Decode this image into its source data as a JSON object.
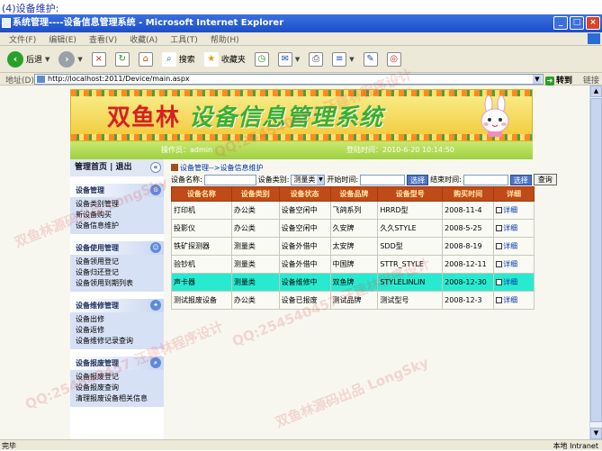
{
  "caption": "(4)设备维护:",
  "window": {
    "title": "系统管理----设备信息管理系统 - Microsoft Internet Explorer",
    "controls": [
      "_",
      "□",
      "×"
    ]
  },
  "menu": [
    "文件(F)",
    "编辑(E)",
    "查看(V)",
    "收藏(A)",
    "工具(T)",
    "帮助(H)"
  ],
  "toolbar": {
    "back_label": "后退",
    "search_label": "搜索",
    "favorites_label": "收藏夹"
  },
  "address": {
    "label": "地址(D)",
    "url": "http://localhost:2011/Device/main.aspx",
    "go_label": "转到",
    "links_label": "链接"
  },
  "banner": {
    "title_red": "双鱼林",
    "title_green": "设备信息管理系统"
  },
  "infobar": {
    "operator": "操作员：admin",
    "login_time": "登陆时间：2010-6-20 10:14:50"
  },
  "sidebar": {
    "top_links": "管理首页 | 退出",
    "collapse": "«",
    "groups": [
      {
        "title": "设备管理",
        "items": [
          "设备类别管理",
          "新设备购买",
          "设备信息维护"
        ]
      },
      {
        "title": "设备使用管理",
        "items": [
          "设备领用登记",
          "设备归还登记",
          "设备领用到期列表"
        ]
      },
      {
        "title": "设备维修管理",
        "items": [
          "设备出修",
          "设备返修",
          "设备维修记录查询"
        ]
      },
      {
        "title": "设备报废管理",
        "items": [
          "设备报废登记",
          "设备报废查询",
          "清理报废设备相关信息"
        ]
      }
    ]
  },
  "breadcrumb": "设备管理-->设备信息维护",
  "search": {
    "name_label": "设备名称:",
    "type_label": "设备类别:",
    "type_value": "测量类",
    "start_label": "开始时间:",
    "select1": "选择",
    "end_label": "结束时间:",
    "select2": "选择",
    "query": "查询"
  },
  "table": {
    "headers": [
      "设备名称",
      "设备类别",
      "设备状态",
      "设备品牌",
      "设备型号",
      "购买时间",
      "详细"
    ],
    "rows": [
      [
        "打印机",
        "办公类",
        "设备空闲中",
        "飞鸽系列",
        "HRRD型",
        "2008-11-4",
        "详细"
      ],
      [
        "投影仪",
        "办公类",
        "设备空闲中",
        "久安牌",
        "久久STYLE",
        "2008-5-25",
        "详细"
      ],
      [
        "铁矿探测器",
        "测量类",
        "设备外借中",
        "太安牌",
        "SDD型",
        "2008-8-19",
        "详细"
      ],
      [
        "验钞机",
        "测量类",
        "设备外借中",
        "中国牌",
        "STTR_STYLE",
        "2008-12-11",
        "详细"
      ],
      [
        "声卡器",
        "测量类",
        "设备维修中",
        "双鱼牌",
        "STYLELINLIN",
        "2008-12-30",
        "详细"
      ],
      [
        "测试报废设备",
        "办公类",
        "设备已报废",
        "测试品牌",
        "测试型号",
        "2008-12-3",
        "详细"
      ]
    ],
    "highlight_row": 4
  },
  "status": {
    "left": "完毕",
    "right": "本地 Intranet"
  },
  "watermark": "QQ:254540457 汪建林程序设计",
  "watermark2": "双鱼林源码出品 LongSky"
}
